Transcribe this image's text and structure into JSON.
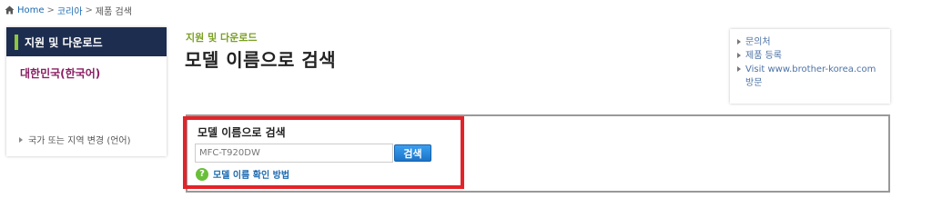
{
  "breadcrumb": {
    "items": [
      "Home",
      "코리아",
      "제품 검색"
    ],
    "separator": ">"
  },
  "sidebar": {
    "header": "지원 및 다운로드",
    "region": "대한민국(한국어)",
    "change_link": "국가 또는 지역 변경 (언어)"
  },
  "main": {
    "eyebrow": "지원 및 다운로드",
    "title": "모델 이름으로 검색"
  },
  "quick_links": [
    "문의처",
    "제품 등록",
    "Visit www.brother-korea.com 방문"
  ],
  "search": {
    "label": "모델 이름으로 검색",
    "value": "MFC-T920DW",
    "button": "검색",
    "help": "모델 이름 확인 방법",
    "help_glyph": "?"
  },
  "colors": {
    "sidebar_header_bg": "#1d2d4f",
    "accent_green": "#8dc63f",
    "region_text": "#8a1e63",
    "search_button": "#1c74c8",
    "highlight": "#e32329"
  }
}
